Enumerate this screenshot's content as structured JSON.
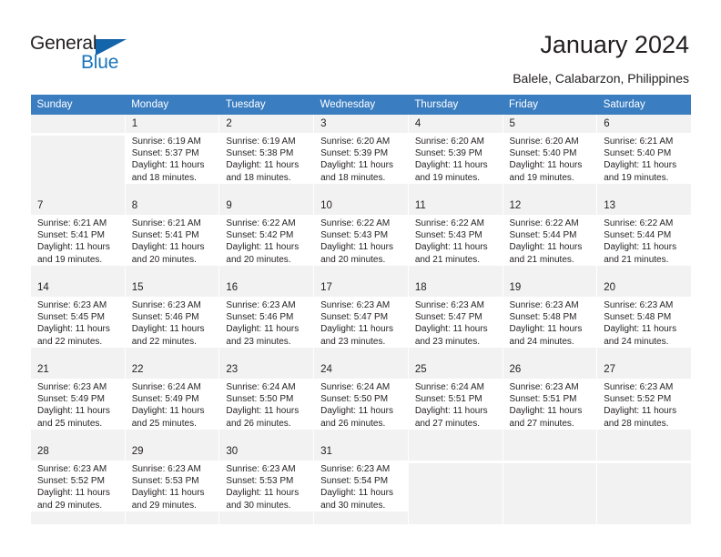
{
  "brand": {
    "name_part1": "General",
    "name_part2": "Blue",
    "triangle_icon": "triangle-icon",
    "color_dark": "#231f20",
    "color_blue": "#1a75bc"
  },
  "header": {
    "title": "January 2024",
    "subtitle": "Balele, Calabarzon, Philippines"
  },
  "calendar": {
    "header_bg": "#3a7dc1",
    "shade_bg": "#f2f2f2",
    "weekday_headers": [
      "Sunday",
      "Monday",
      "Tuesday",
      "Wednesday",
      "Thursday",
      "Friday",
      "Saturday"
    ],
    "weeks": [
      [
        {
          "day": "",
          "sunrise": "",
          "sunset": "",
          "daylight_1": "",
          "daylight_2": "",
          "empty": true
        },
        {
          "day": "1",
          "sunrise": "Sunrise: 6:19 AM",
          "sunset": "Sunset: 5:37 PM",
          "daylight_1": "Daylight: 11 hours",
          "daylight_2": "and 18 minutes."
        },
        {
          "day": "2",
          "sunrise": "Sunrise: 6:19 AM",
          "sunset": "Sunset: 5:38 PM",
          "daylight_1": "Daylight: 11 hours",
          "daylight_2": "and 18 minutes."
        },
        {
          "day": "3",
          "sunrise": "Sunrise: 6:20 AM",
          "sunset": "Sunset: 5:39 PM",
          "daylight_1": "Daylight: 11 hours",
          "daylight_2": "and 18 minutes."
        },
        {
          "day": "4",
          "sunrise": "Sunrise: 6:20 AM",
          "sunset": "Sunset: 5:39 PM",
          "daylight_1": "Daylight: 11 hours",
          "daylight_2": "and 19 minutes."
        },
        {
          "day": "5",
          "sunrise": "Sunrise: 6:20 AM",
          "sunset": "Sunset: 5:40 PM",
          "daylight_1": "Daylight: 11 hours",
          "daylight_2": "and 19 minutes."
        },
        {
          "day": "6",
          "sunrise": "Sunrise: 6:21 AM",
          "sunset": "Sunset: 5:40 PM",
          "daylight_1": "Daylight: 11 hours",
          "daylight_2": "and 19 minutes."
        }
      ],
      [
        {
          "day": "7",
          "sunrise": "Sunrise: 6:21 AM",
          "sunset": "Sunset: 5:41 PM",
          "daylight_1": "Daylight: 11 hours",
          "daylight_2": "and 19 minutes."
        },
        {
          "day": "8",
          "sunrise": "Sunrise: 6:21 AM",
          "sunset": "Sunset: 5:41 PM",
          "daylight_1": "Daylight: 11 hours",
          "daylight_2": "and 20 minutes."
        },
        {
          "day": "9",
          "sunrise": "Sunrise: 6:22 AM",
          "sunset": "Sunset: 5:42 PM",
          "daylight_1": "Daylight: 11 hours",
          "daylight_2": "and 20 minutes."
        },
        {
          "day": "10",
          "sunrise": "Sunrise: 6:22 AM",
          "sunset": "Sunset: 5:43 PM",
          "daylight_1": "Daylight: 11 hours",
          "daylight_2": "and 20 minutes."
        },
        {
          "day": "11",
          "sunrise": "Sunrise: 6:22 AM",
          "sunset": "Sunset: 5:43 PM",
          "daylight_1": "Daylight: 11 hours",
          "daylight_2": "and 21 minutes."
        },
        {
          "day": "12",
          "sunrise": "Sunrise: 6:22 AM",
          "sunset": "Sunset: 5:44 PM",
          "daylight_1": "Daylight: 11 hours",
          "daylight_2": "and 21 minutes."
        },
        {
          "day": "13",
          "sunrise": "Sunrise: 6:22 AM",
          "sunset": "Sunset: 5:44 PM",
          "daylight_1": "Daylight: 11 hours",
          "daylight_2": "and 21 minutes."
        }
      ],
      [
        {
          "day": "14",
          "sunrise": "Sunrise: 6:23 AM",
          "sunset": "Sunset: 5:45 PM",
          "daylight_1": "Daylight: 11 hours",
          "daylight_2": "and 22 minutes."
        },
        {
          "day": "15",
          "sunrise": "Sunrise: 6:23 AM",
          "sunset": "Sunset: 5:46 PM",
          "daylight_1": "Daylight: 11 hours",
          "daylight_2": "and 22 minutes."
        },
        {
          "day": "16",
          "sunrise": "Sunrise: 6:23 AM",
          "sunset": "Sunset: 5:46 PM",
          "daylight_1": "Daylight: 11 hours",
          "daylight_2": "and 23 minutes."
        },
        {
          "day": "17",
          "sunrise": "Sunrise: 6:23 AM",
          "sunset": "Sunset: 5:47 PM",
          "daylight_1": "Daylight: 11 hours",
          "daylight_2": "and 23 minutes."
        },
        {
          "day": "18",
          "sunrise": "Sunrise: 6:23 AM",
          "sunset": "Sunset: 5:47 PM",
          "daylight_1": "Daylight: 11 hours",
          "daylight_2": "and 23 minutes."
        },
        {
          "day": "19",
          "sunrise": "Sunrise: 6:23 AM",
          "sunset": "Sunset: 5:48 PM",
          "daylight_1": "Daylight: 11 hours",
          "daylight_2": "and 24 minutes."
        },
        {
          "day": "20",
          "sunrise": "Sunrise: 6:23 AM",
          "sunset": "Sunset: 5:48 PM",
          "daylight_1": "Daylight: 11 hours",
          "daylight_2": "and 24 minutes."
        }
      ],
      [
        {
          "day": "21",
          "sunrise": "Sunrise: 6:23 AM",
          "sunset": "Sunset: 5:49 PM",
          "daylight_1": "Daylight: 11 hours",
          "daylight_2": "and 25 minutes."
        },
        {
          "day": "22",
          "sunrise": "Sunrise: 6:24 AM",
          "sunset": "Sunset: 5:49 PM",
          "daylight_1": "Daylight: 11 hours",
          "daylight_2": "and 25 minutes."
        },
        {
          "day": "23",
          "sunrise": "Sunrise: 6:24 AM",
          "sunset": "Sunset: 5:50 PM",
          "daylight_1": "Daylight: 11 hours",
          "daylight_2": "and 26 minutes."
        },
        {
          "day": "24",
          "sunrise": "Sunrise: 6:24 AM",
          "sunset": "Sunset: 5:50 PM",
          "daylight_1": "Daylight: 11 hours",
          "daylight_2": "and 26 minutes."
        },
        {
          "day": "25",
          "sunrise": "Sunrise: 6:24 AM",
          "sunset": "Sunset: 5:51 PM",
          "daylight_1": "Daylight: 11 hours",
          "daylight_2": "and 27 minutes."
        },
        {
          "day": "26",
          "sunrise": "Sunrise: 6:23 AM",
          "sunset": "Sunset: 5:51 PM",
          "daylight_1": "Daylight: 11 hours",
          "daylight_2": "and 27 minutes."
        },
        {
          "day": "27",
          "sunrise": "Sunrise: 6:23 AM",
          "sunset": "Sunset: 5:52 PM",
          "daylight_1": "Daylight: 11 hours",
          "daylight_2": "and 28 minutes."
        }
      ],
      [
        {
          "day": "28",
          "sunrise": "Sunrise: 6:23 AM",
          "sunset": "Sunset: 5:52 PM",
          "daylight_1": "Daylight: 11 hours",
          "daylight_2": "and 29 minutes."
        },
        {
          "day": "29",
          "sunrise": "Sunrise: 6:23 AM",
          "sunset": "Sunset: 5:53 PM",
          "daylight_1": "Daylight: 11 hours",
          "daylight_2": "and 29 minutes."
        },
        {
          "day": "30",
          "sunrise": "Sunrise: 6:23 AM",
          "sunset": "Sunset: 5:53 PM",
          "daylight_1": "Daylight: 11 hours",
          "daylight_2": "and 30 minutes."
        },
        {
          "day": "31",
          "sunrise": "Sunrise: 6:23 AM",
          "sunset": "Sunset: 5:54 PM",
          "daylight_1": "Daylight: 11 hours",
          "daylight_2": "and 30 minutes."
        },
        {
          "day": "",
          "sunrise": "",
          "sunset": "",
          "daylight_1": "",
          "daylight_2": "",
          "empty": true
        },
        {
          "day": "",
          "sunrise": "",
          "sunset": "",
          "daylight_1": "",
          "daylight_2": "",
          "empty": true
        },
        {
          "day": "",
          "sunrise": "",
          "sunset": "",
          "daylight_1": "",
          "daylight_2": "",
          "empty": true
        }
      ]
    ]
  }
}
